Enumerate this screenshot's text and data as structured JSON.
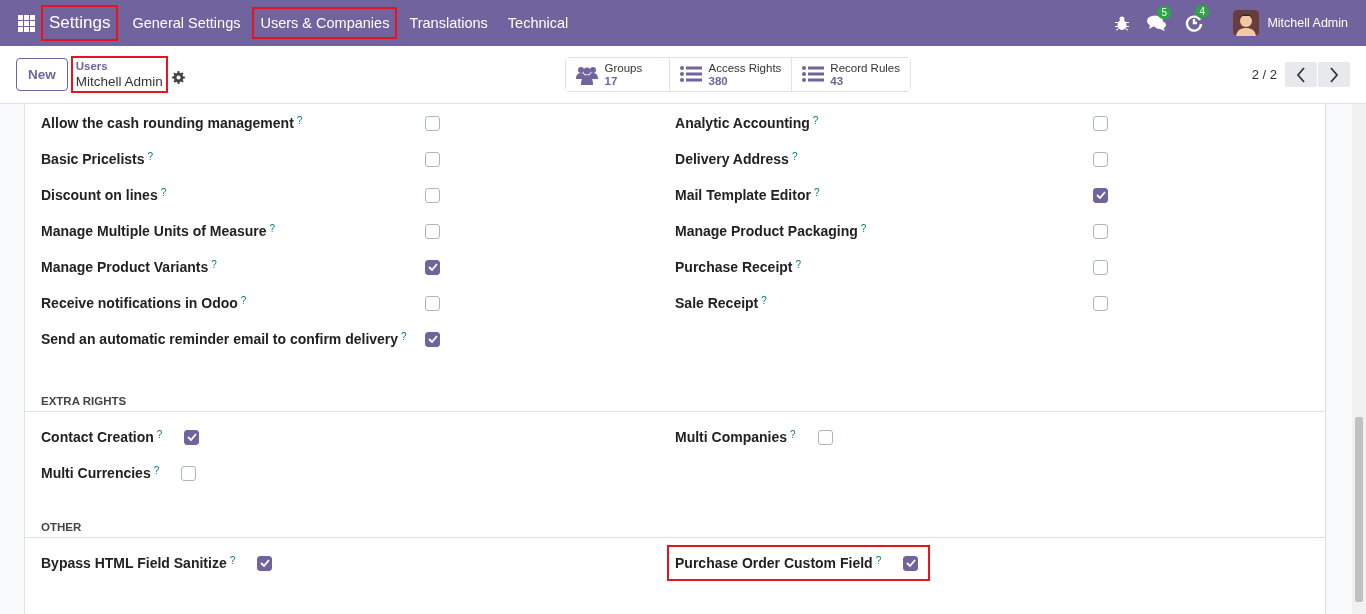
{
  "navbar": {
    "brand": {
      "label": "Settings",
      "highlighted": true
    },
    "menu": [
      {
        "label": "General Settings",
        "highlighted": false
      },
      {
        "label": "Users & Companies",
        "highlighted": true
      },
      {
        "label": "Translations",
        "highlighted": false
      },
      {
        "label": "Technical",
        "highlighted": false
      }
    ],
    "systray": {
      "messages_badge": "5",
      "activities_badge": "4",
      "user_name": "Mitchell Admin"
    }
  },
  "control_panel": {
    "new_button": "New",
    "breadcrumb": {
      "parent": "Users",
      "current": "Mitchell Admin",
      "highlighted": true
    },
    "stat_buttons": [
      {
        "kind": "groups",
        "label": "Groups",
        "value": "17"
      },
      {
        "kind": "list",
        "label": "Access Rights",
        "value": "380"
      },
      {
        "kind": "list",
        "label": "Record Rules",
        "value": "43"
      }
    ],
    "pager": "2 / 2"
  },
  "sections": [
    {
      "kind": "aligned",
      "left": [
        {
          "label": "Allow the cash rounding management",
          "help": "?",
          "checked": false,
          "highlighted": false
        },
        {
          "label": "Basic Pricelists",
          "help": "?",
          "checked": false,
          "highlighted": false
        },
        {
          "label": "Discount on lines",
          "help": "?",
          "checked": false,
          "highlighted": false
        },
        {
          "label": "Manage Multiple Units of Measure",
          "help": "?",
          "checked": false,
          "highlighted": false
        },
        {
          "label": "Manage Product Variants",
          "help": "?",
          "checked": true,
          "highlighted": false
        },
        {
          "label": "Receive notifications in Odoo",
          "help": "?",
          "checked": false,
          "highlighted": false
        },
        {
          "label": "Send an automatic reminder email to confirm delivery",
          "help": "?",
          "checked": true,
          "highlighted": false
        }
      ],
      "right": [
        {
          "label": "Analytic Accounting",
          "help": "?",
          "checked": false,
          "highlighted": false
        },
        {
          "label": "Delivery Address",
          "help": "?",
          "checked": false,
          "highlighted": false
        },
        {
          "label": "Mail Template Editor",
          "help": "?",
          "checked": true,
          "highlighted": false
        },
        {
          "label": "Manage Product Packaging",
          "help": "?",
          "checked": false,
          "highlighted": false
        },
        {
          "label": "Purchase Receipt",
          "help": "?",
          "checked": false,
          "highlighted": false
        },
        {
          "label": "Sale Receipt",
          "help": "?",
          "checked": false,
          "highlighted": false
        }
      ]
    },
    {
      "heading": "EXTRA RIGHTS",
      "kind": "inline",
      "left": [
        {
          "label": "Contact Creation",
          "help": "?",
          "checked": true,
          "highlighted": false
        },
        {
          "label": "Multi Currencies",
          "help": "?",
          "checked": false,
          "highlighted": false
        }
      ],
      "right": [
        {
          "label": "Multi Companies",
          "help": "?",
          "checked": false,
          "highlighted": false
        }
      ]
    },
    {
      "heading": "OTHER",
      "kind": "inline",
      "left": [
        {
          "label": "Bypass HTML Field Sanitize",
          "help": "?",
          "checked": true,
          "highlighted": false
        }
      ],
      "right": [
        {
          "label": "Purchase Order Custom Field",
          "help": "?",
          "checked": true,
          "highlighted": true
        }
      ]
    }
  ]
}
